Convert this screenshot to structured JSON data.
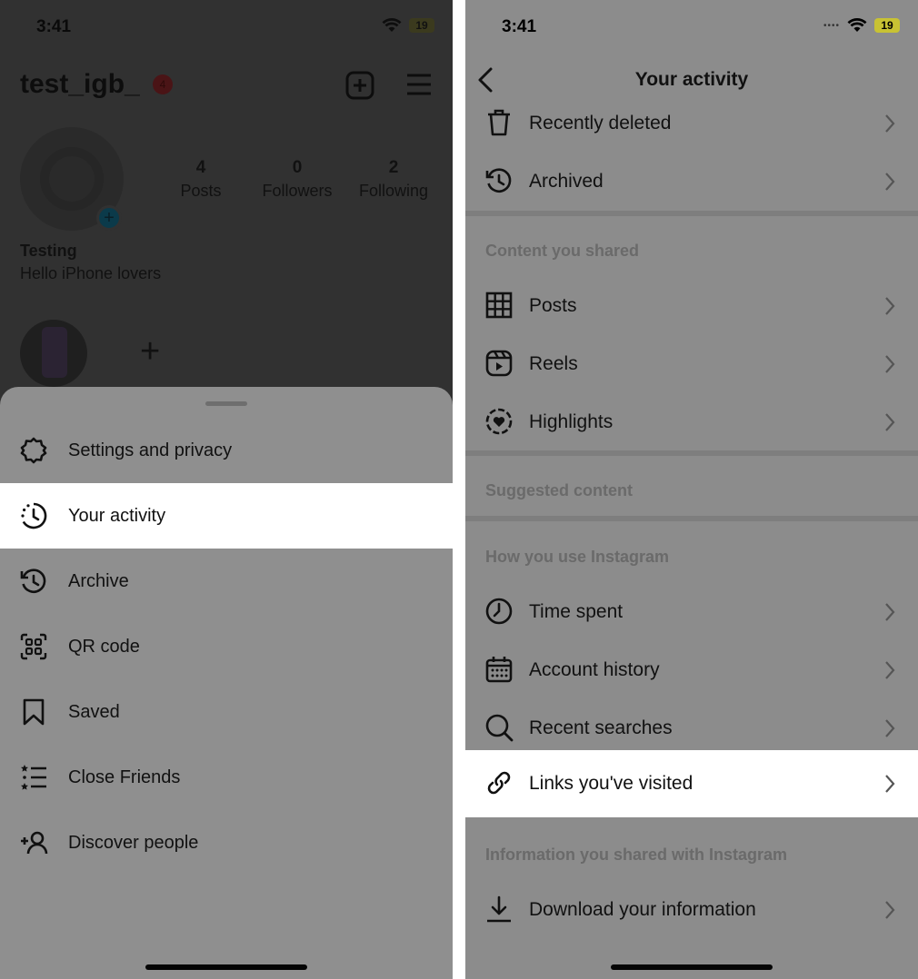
{
  "left_screen": {
    "status_bar": {
      "time": "3:41",
      "battery": "19"
    },
    "profile": {
      "username": "test_igb_",
      "notification_count": "4",
      "stats": [
        {
          "value": "4",
          "label": "Posts"
        },
        {
          "value": "0",
          "label": "Followers"
        },
        {
          "value": "2",
          "label": "Following"
        }
      ],
      "display_name": "Testing",
      "bio": "Hello iPhone lovers",
      "new_highlight_glyph": "+"
    },
    "menu": {
      "items": [
        {
          "label": "Settings and privacy",
          "icon": "settings-gear-icon",
          "active": false
        },
        {
          "label": "Your activity",
          "icon": "activity-clock-icon",
          "active": true
        },
        {
          "label": "Archive",
          "icon": "archive-history-icon",
          "active": false
        },
        {
          "label": "QR code",
          "icon": "qr-code-icon",
          "active": false
        },
        {
          "label": "Saved",
          "icon": "bookmark-icon",
          "active": false
        },
        {
          "label": "Close Friends",
          "icon": "close-friends-list-icon",
          "active": false
        },
        {
          "label": "Discover people",
          "icon": "add-person-icon",
          "active": false
        }
      ]
    }
  },
  "right_screen": {
    "status_bar": {
      "time": "3:41",
      "battery": "19"
    },
    "header": {
      "title": "Your activity"
    },
    "rows_top": [
      {
        "label": "Recently deleted",
        "icon": "trash-icon"
      },
      {
        "label": "Archived",
        "icon": "archive-history-icon"
      }
    ],
    "section_content_shared": "Content you shared",
    "rows_shared": [
      {
        "label": "Posts",
        "icon": "grid-icon"
      },
      {
        "label": "Reels",
        "icon": "reels-icon"
      },
      {
        "label": "Highlights",
        "icon": "highlights-heart-icon"
      }
    ],
    "section_suggested": "Suggested content",
    "section_how_you_use": "How you use Instagram",
    "rows_usage": [
      {
        "label": "Time spent",
        "icon": "clock-icon"
      },
      {
        "label": "Account history",
        "icon": "calendar-icon"
      },
      {
        "label": "Recent searches",
        "icon": "search-icon"
      },
      {
        "label": "Links you've visited",
        "icon": "link-icon",
        "active": true
      }
    ],
    "section_info_shared": "Information you shared with Instagram",
    "rows_info": [
      {
        "label": "Download your information",
        "icon": "download-icon"
      }
    ]
  },
  "colors": {
    "dim_background": "#313131",
    "sheet_background": "#8f8f8f",
    "highlight_row": "#ffffff",
    "right_background": "#8c8c8c"
  }
}
